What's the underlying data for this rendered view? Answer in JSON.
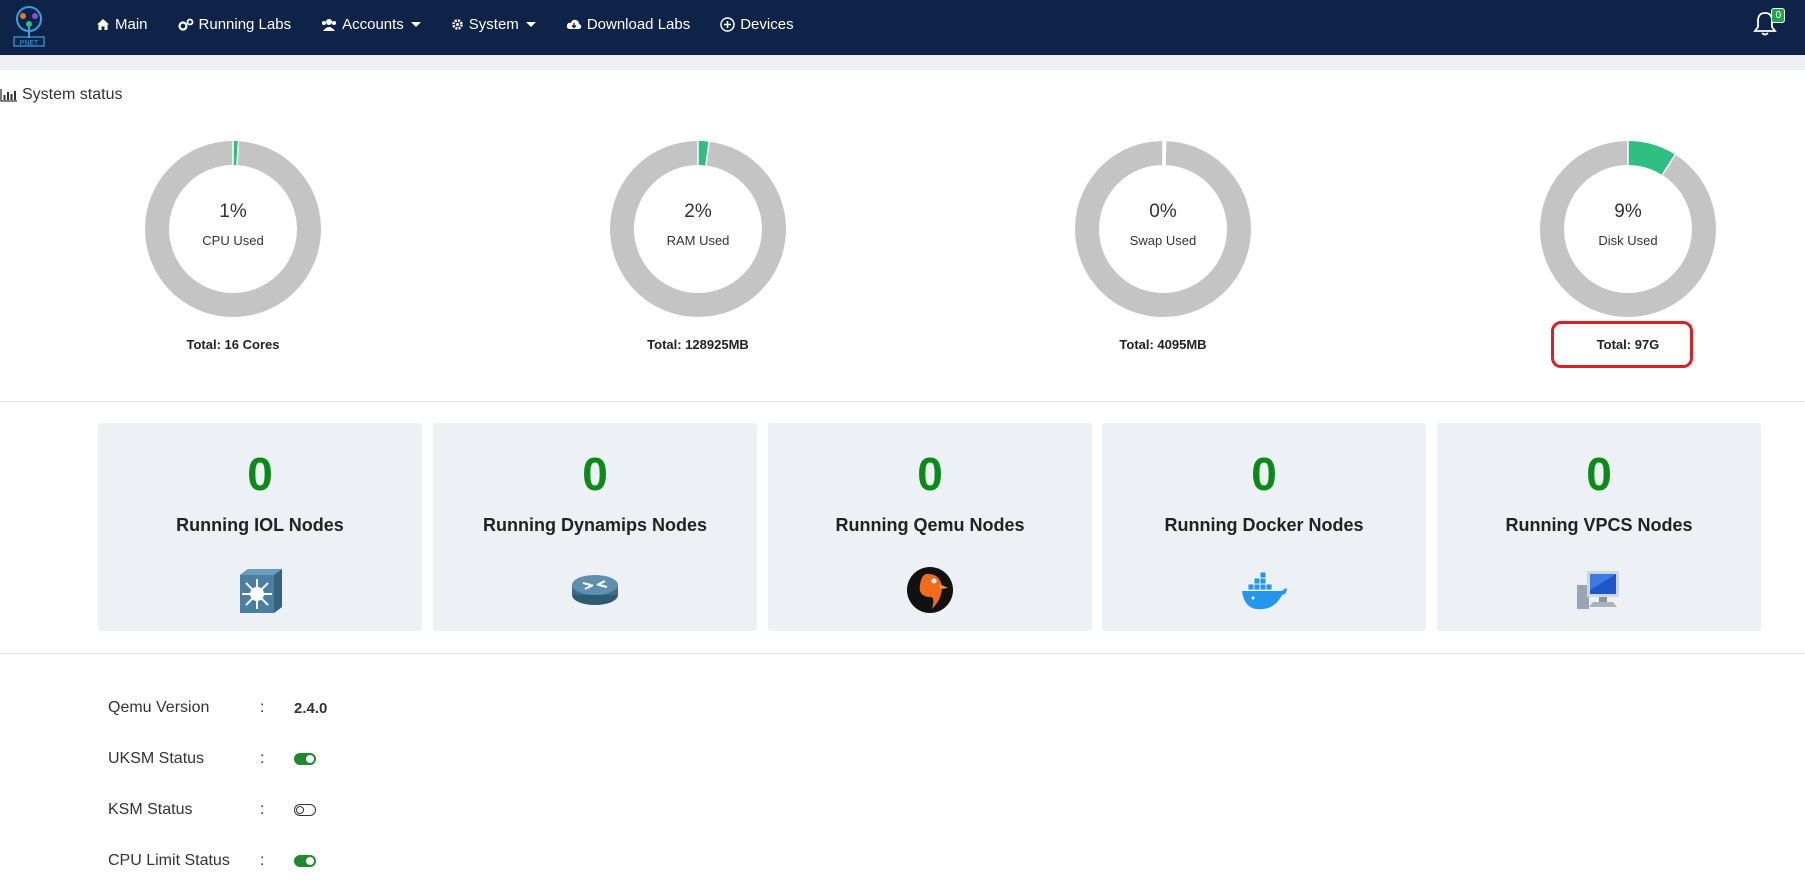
{
  "navbar": {
    "logo_text": "PNET",
    "items": [
      {
        "label": "Main",
        "icon": "home-icon"
      },
      {
        "label": "Running Labs",
        "icon": "gears-icon"
      },
      {
        "label": "Accounts",
        "icon": "users-icon",
        "dropdown": true
      },
      {
        "label": "System",
        "icon": "gear-icon",
        "dropdown": true
      },
      {
        "label": "Download Labs",
        "icon": "cloud-download-icon"
      },
      {
        "label": "Devices",
        "icon": "plus-circle-icon"
      }
    ],
    "notifications_count": "0"
  },
  "system_status": {
    "title": "System status",
    "gauges": [
      {
        "percent": "1%",
        "label": "CPU Used",
        "total": "Total: 16 Cores",
        "value": 1
      },
      {
        "percent": "2%",
        "label": "RAM Used",
        "total": "Total: 128925MB",
        "value": 2
      },
      {
        "percent": "0%",
        "label": "Swap Used",
        "total": "Total: 4095MB",
        "value": 0
      },
      {
        "percent": "9%",
        "label": "Disk Used",
        "total": "Total: 97G",
        "value": 9
      }
    ],
    "colors": {
      "used": "#2ebf83",
      "free": "#c4c4c4"
    }
  },
  "nodes": [
    {
      "count": "0",
      "label": "Running IOL Nodes",
      "icon": "switch-icon"
    },
    {
      "count": "0",
      "label": "Running Dynamips Nodes",
      "icon": "router-icon"
    },
    {
      "count": "0",
      "label": "Running Qemu Nodes",
      "icon": "qemu-icon"
    },
    {
      "count": "0",
      "label": "Running Docker Nodes",
      "icon": "docker-icon"
    },
    {
      "count": "0",
      "label": "Running VPCS Nodes",
      "icon": "computer-icon"
    }
  ],
  "info": [
    {
      "label": "Qemu Version",
      "colon": ":",
      "value": "2.4.0"
    },
    {
      "label": "UKSM Status",
      "colon": ":",
      "toggle": true
    },
    {
      "label": "KSM Status",
      "colon": ":",
      "toggle": false
    },
    {
      "label": "CPU Limit Status",
      "colon": ":",
      "toggle": true
    }
  ]
}
